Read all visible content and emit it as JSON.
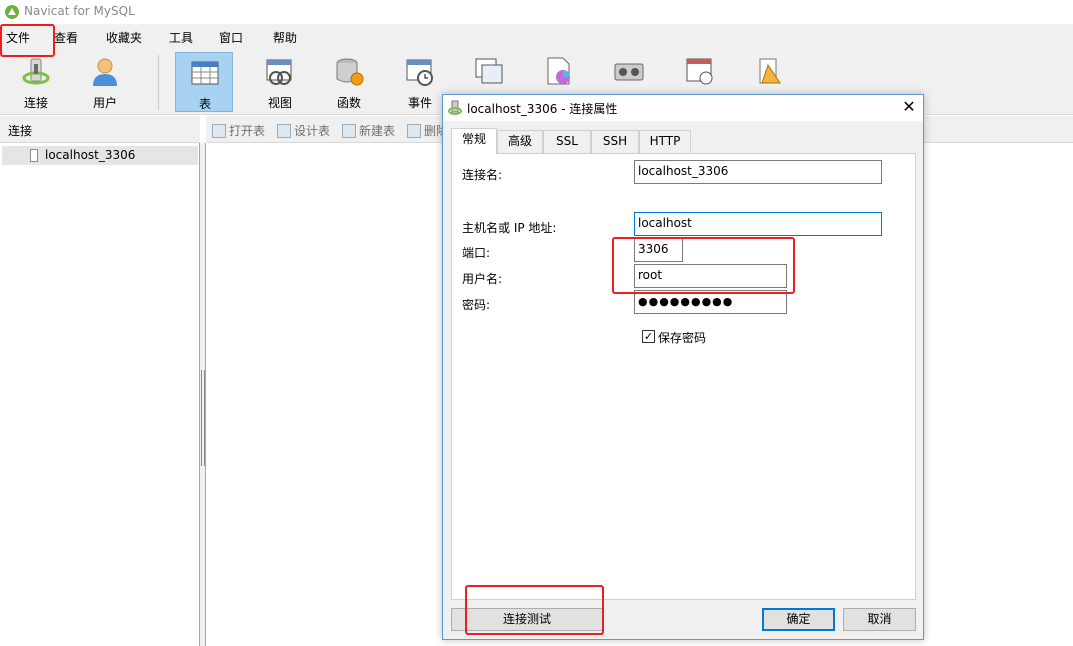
{
  "app": {
    "title": "Navicat for MySQL"
  },
  "menu": [
    "文件",
    "查看",
    "收藏夹",
    "工具",
    "窗口",
    "帮助"
  ],
  "toolbar": {
    "buttons": [
      {
        "label": "连接",
        "icon": "connection-icon"
      },
      {
        "label": "用户",
        "icon": "user-icon"
      },
      {
        "label": "表",
        "icon": "table-icon",
        "active": true
      },
      {
        "label": "视图",
        "icon": "view-icon"
      },
      {
        "label": "函数",
        "icon": "function-icon"
      },
      {
        "label": "事件",
        "icon": "event-icon"
      }
    ]
  },
  "sidebar": {
    "header": "连接",
    "items": [
      {
        "label": "localhost_3306"
      }
    ]
  },
  "object_toolbar": [
    "打开表",
    "设计表",
    "新建表",
    "删除"
  ],
  "dialog": {
    "title": "localhost_3306 - 连接属性",
    "tabs": [
      "常规",
      "高级",
      "SSL",
      "SSH",
      "HTTP"
    ],
    "active_tab": "常规",
    "fields": {
      "connection_name": {
        "label": "连接名:",
        "value": "localhost_3306"
      },
      "host": {
        "label": "主机名或 IP 地址:",
        "value": "localhost"
      },
      "port": {
        "label": "端口:",
        "value": "3306"
      },
      "username": {
        "label": "用户名:",
        "value": "root"
      },
      "password": {
        "label": "密码:",
        "value": "●●●●●●●●●"
      }
    },
    "save_password": {
      "label": "保存密码",
      "checked": true,
      "mark": "✓"
    },
    "buttons": {
      "test": "连接测试",
      "ok": "确定",
      "cancel": "取消"
    },
    "close": "✕"
  },
  "colors": {
    "accent": "#0078d7",
    "annotation": "#e8201f",
    "active_tool": "#a8d2f2"
  }
}
